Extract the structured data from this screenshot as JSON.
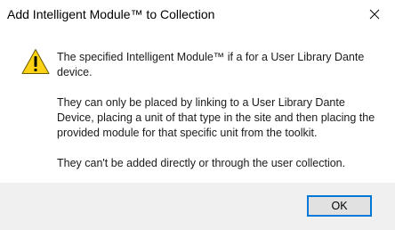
{
  "window": {
    "title": "Add Intelligent Module™ to Collection",
    "close_icon": "close-icon"
  },
  "message": {
    "icon": "warning-icon",
    "paragraphs": [
      "The specified Intelligent Module™ if a for a User Library Dante device.",
      "They can only be placed by linking to a User Library Dante Device, placing a unit of that type in the site and then placing the provided module for that specific unit from the toolkit.",
      "They can't be added directly or through the user collection."
    ]
  },
  "buttons": {
    "ok_label": "OK"
  },
  "colors": {
    "accent": "#0078d7",
    "footer_bg": "#f0f0f0",
    "warning_fill": "#fcd116"
  }
}
